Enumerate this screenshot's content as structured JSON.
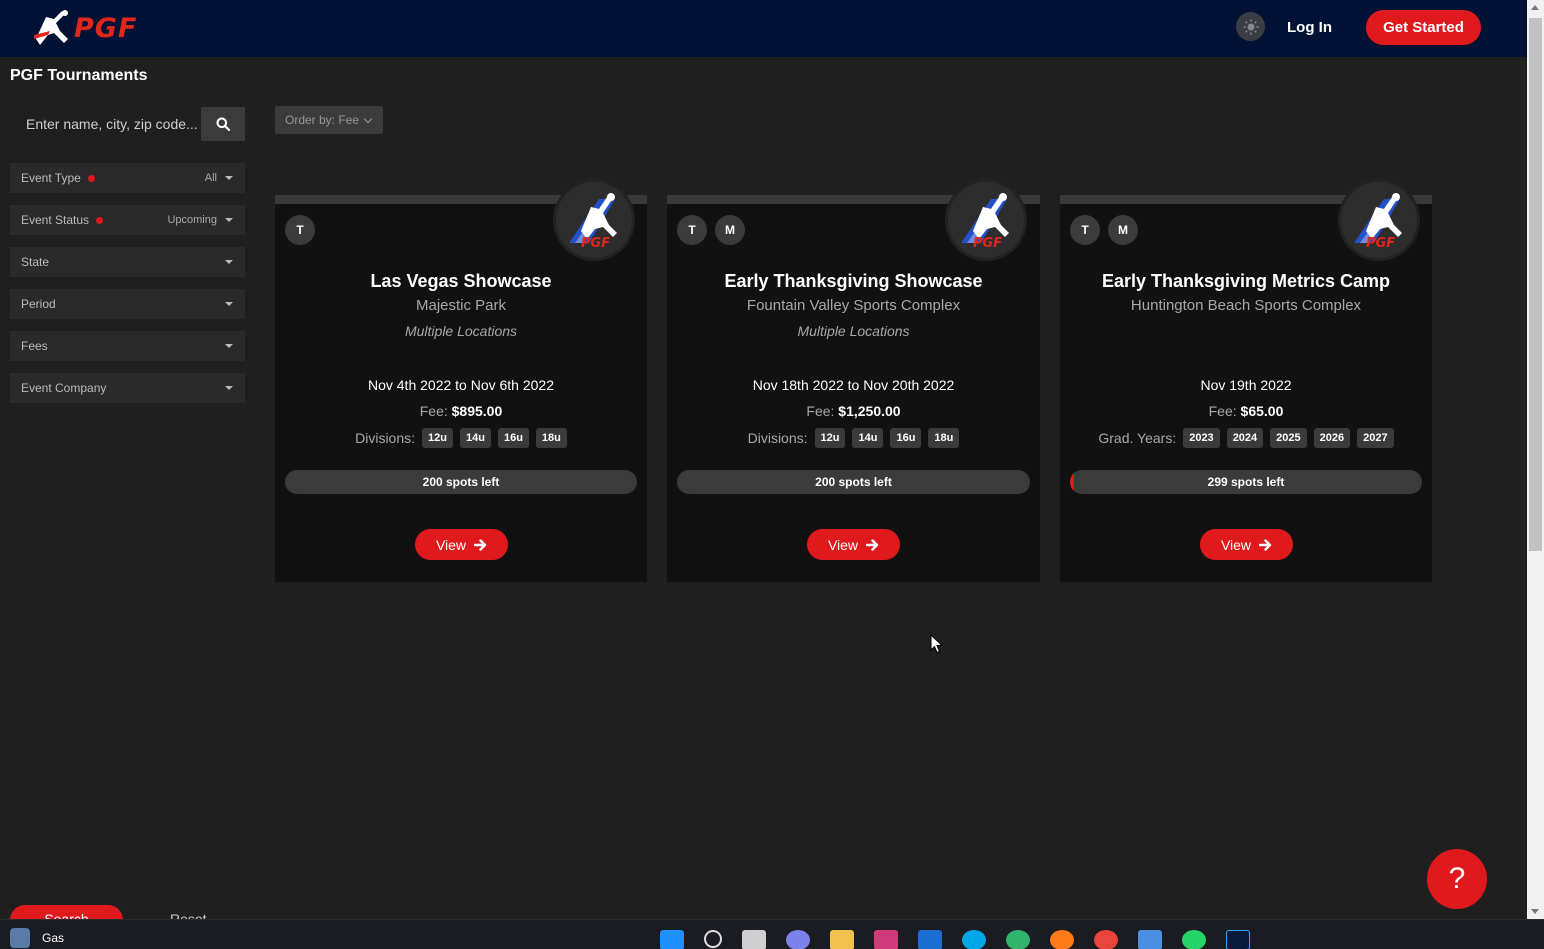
{
  "header": {
    "brand": "PGF",
    "login_label": "Log In",
    "get_started_label": "Get Started"
  },
  "page_title": "PGF Tournaments",
  "sidebar": {
    "search_placeholder": "Enter name, city, zip code...",
    "filters": [
      {
        "label": "Event Type",
        "value": "All",
        "active": true
      },
      {
        "label": "Event Status",
        "value": "Upcoming",
        "active": true
      },
      {
        "label": "State",
        "value": ""
      },
      {
        "label": "Period",
        "value": ""
      },
      {
        "label": "Fees",
        "value": ""
      },
      {
        "label": "Event Company",
        "value": ""
      }
    ],
    "search_label": "Search",
    "reset_label": "Reset"
  },
  "order_label": "Order by: Fee",
  "cards": [
    {
      "badges": [
        "T"
      ],
      "title": "Las Vegas Showcase",
      "venue": "Majestic Park",
      "locations": "Multiple Locations",
      "dates": "Nov 4th 2022 to Nov 6th 2022",
      "fee_label": "Fee:",
      "fee": "$895.00",
      "divisions_label": "Divisions:",
      "divisions": [
        "12u",
        "14u",
        "16u",
        "18u"
      ],
      "spots": "200 spots left",
      "spots_filled_fraction": 0,
      "view_label": "View"
    },
    {
      "badges": [
        "T",
        "M"
      ],
      "title": "Early Thanksgiving Showcase",
      "venue": "Fountain Valley Sports Complex",
      "locations": "Multiple Locations",
      "dates": "Nov 18th 2022 to Nov 20th 2022",
      "fee_label": "Fee:",
      "fee": "$1,250.00",
      "divisions_label": "Divisions:",
      "divisions": [
        "12u",
        "14u",
        "16u",
        "18u"
      ],
      "spots": "200 spots left",
      "spots_filled_fraction": 0,
      "view_label": "View"
    },
    {
      "badges": [
        "T",
        "M"
      ],
      "title": "Early Thanksgiving Metrics Camp",
      "venue": "Huntington Beach Sports Complex",
      "locations": "",
      "dates": "Nov 19th 2022",
      "fee_label": "Fee:",
      "fee": "$65.00",
      "divisions_label": "Grad. Years:",
      "divisions": [
        "2023",
        "2024",
        "2025",
        "2026",
        "2027"
      ],
      "spots": "299 spots left",
      "spots_filled_fraction": 0.01,
      "view_label": "View"
    }
  ],
  "help_label": "?",
  "taskbar": {
    "weather_text": "Gas",
    "apps": [
      "windows-start",
      "search",
      "task-view",
      "teams",
      "file-explorer",
      "store",
      "mail",
      "skype",
      "edge",
      "firefox",
      "chrome",
      "sublime",
      "whatsapp",
      "photoshop"
    ]
  },
  "colors": {
    "header_bg": "#021235",
    "accent": "#e0191c",
    "page_bg": "#1f1f1f",
    "card_bg": "#111111"
  }
}
